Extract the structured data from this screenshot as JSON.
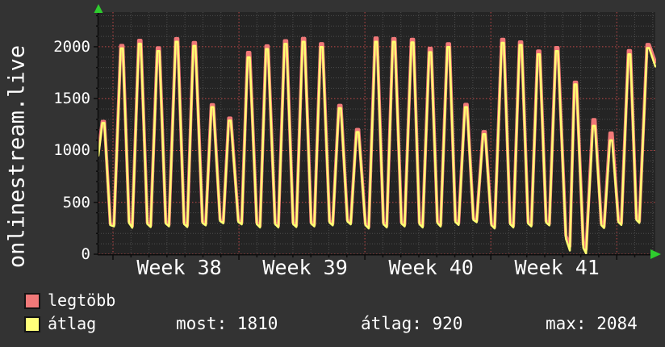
{
  "chart_data": {
    "type": "line",
    "ylabel": "onlinestream.live",
    "y_ticks": [
      0,
      500,
      1000,
      1500,
      2000
    ],
    "ylim": [
      0,
      2334
    ],
    "xlim_days": [
      0,
      30.95
    ],
    "week_start_day": 0.807,
    "x_tick_labels": [
      "Week 38",
      "Week 39",
      "Week 40",
      "Week 41"
    ],
    "grid": {
      "minor_y_step": 100,
      "major_y_step": 500,
      "minor_x_step_days": 1,
      "major_x_step_days": 7,
      "minor_color": "#4d4d4d",
      "major_color": "#c04848"
    },
    "series": [
      {
        "name": "legtöbb",
        "color": "#f07878",
        "points": [
          [
            0.0,
            1000
          ],
          [
            0.21,
            1280
          ],
          [
            0.33,
            1280
          ],
          [
            0.66,
            295
          ],
          [
            0.86,
            283
          ],
          [
            1.24,
            2012
          ],
          [
            1.36,
            2012
          ],
          [
            1.7,
            315
          ],
          [
            1.88,
            270
          ],
          [
            2.24,
            2062
          ],
          [
            2.36,
            2062
          ],
          [
            2.72,
            305
          ],
          [
            2.9,
            277
          ],
          [
            3.27,
            1990
          ],
          [
            3.39,
            1990
          ],
          [
            3.74,
            310
          ],
          [
            3.92,
            283
          ],
          [
            4.29,
            2078
          ],
          [
            4.41,
            2078
          ],
          [
            4.76,
            305
          ],
          [
            4.94,
            277
          ],
          [
            5.27,
            2040
          ],
          [
            5.39,
            2040
          ],
          [
            5.78,
            315
          ],
          [
            5.96,
            293
          ],
          [
            6.27,
            1442
          ],
          [
            6.39,
            1442
          ],
          [
            6.76,
            335
          ],
          [
            6.94,
            313
          ],
          [
            7.24,
            1312
          ],
          [
            7.36,
            1312
          ],
          [
            7.78,
            325
          ],
          [
            7.96,
            303
          ],
          [
            8.29,
            1945
          ],
          [
            8.41,
            1945
          ],
          [
            8.8,
            305
          ],
          [
            8.98,
            273
          ],
          [
            9.31,
            2008
          ],
          [
            9.43,
            2008
          ],
          [
            9.82,
            305
          ],
          [
            10.0,
            273
          ],
          [
            10.34,
            2058
          ],
          [
            10.46,
            2058
          ],
          [
            10.82,
            305
          ],
          [
            11.0,
            277
          ],
          [
            11.34,
            2080
          ],
          [
            11.46,
            2080
          ],
          [
            11.82,
            310
          ],
          [
            12.0,
            283
          ],
          [
            12.34,
            2030
          ],
          [
            12.46,
            2030
          ],
          [
            12.84,
            320
          ],
          [
            13.02,
            293
          ],
          [
            13.36,
            1435
          ],
          [
            13.48,
            1435
          ],
          [
            13.84,
            330
          ],
          [
            14.02,
            303
          ],
          [
            14.34,
            1202
          ],
          [
            14.46,
            1202
          ],
          [
            14.84,
            295
          ],
          [
            15.02,
            263
          ],
          [
            15.37,
            2084
          ],
          [
            15.49,
            2084
          ],
          [
            15.84,
            305
          ],
          [
            16.02,
            273
          ],
          [
            16.36,
            2078
          ],
          [
            16.48,
            2078
          ],
          [
            16.84,
            310
          ],
          [
            17.02,
            283
          ],
          [
            17.39,
            2072
          ],
          [
            17.51,
            2072
          ],
          [
            17.84,
            305
          ],
          [
            18.02,
            273
          ],
          [
            18.38,
            1985
          ],
          [
            18.5,
            1985
          ],
          [
            18.84,
            315
          ],
          [
            19.02,
            283
          ],
          [
            19.39,
            2028
          ],
          [
            19.51,
            2028
          ],
          [
            19.84,
            325
          ],
          [
            20.02,
            297
          ],
          [
            20.37,
            1444
          ],
          [
            20.49,
            1444
          ],
          [
            20.84,
            345
          ],
          [
            21.02,
            323
          ],
          [
            21.38,
            1182
          ],
          [
            21.5,
            1182
          ],
          [
            21.84,
            295
          ],
          [
            22.02,
            263
          ],
          [
            22.41,
            2072
          ],
          [
            22.53,
            2072
          ],
          [
            22.88,
            305
          ],
          [
            23.06,
            273
          ],
          [
            23.4,
            2046
          ],
          [
            23.52,
            2046
          ],
          [
            23.88,
            310
          ],
          [
            24.06,
            283
          ],
          [
            24.41,
            1958
          ],
          [
            24.53,
            1958
          ],
          [
            24.88,
            320
          ],
          [
            25.06,
            293
          ],
          [
            25.42,
            1992
          ],
          [
            25.54,
            1992
          ],
          [
            25.98,
            180
          ],
          [
            26.2,
            75
          ],
          [
            26.45,
            1658
          ],
          [
            26.57,
            1658
          ],
          [
            26.95,
            95
          ],
          [
            27.1,
            45
          ],
          [
            27.48,
            1298
          ],
          [
            27.6,
            1298
          ],
          [
            27.95,
            295
          ],
          [
            28.1,
            267
          ],
          [
            28.43,
            1168
          ],
          [
            28.55,
            1168
          ],
          [
            28.9,
            325
          ],
          [
            29.06,
            297
          ],
          [
            29.45,
            1962
          ],
          [
            29.57,
            1962
          ],
          [
            29.9,
            345
          ],
          [
            30.06,
            317
          ],
          [
            30.49,
            2022
          ],
          [
            30.61,
            2022
          ],
          [
            30.95,
            1855
          ]
        ]
      },
      {
        "name": "átlag",
        "color": "#ffff72",
        "points": [
          [
            0.0,
            950
          ],
          [
            0.21,
            1265
          ],
          [
            0.33,
            1265
          ],
          [
            0.66,
            280
          ],
          [
            0.86,
            268
          ],
          [
            1.24,
            1985
          ],
          [
            1.36,
            1985
          ],
          [
            1.7,
            300
          ],
          [
            1.88,
            255
          ],
          [
            2.24,
            2030
          ],
          [
            2.36,
            2030
          ],
          [
            2.72,
            290
          ],
          [
            2.9,
            262
          ],
          [
            3.27,
            1958
          ],
          [
            3.39,
            1958
          ],
          [
            3.74,
            295
          ],
          [
            3.92,
            268
          ],
          [
            4.29,
            2048
          ],
          [
            4.41,
            2048
          ],
          [
            4.76,
            290
          ],
          [
            4.94,
            262
          ],
          [
            5.27,
            2008
          ],
          [
            5.39,
            2008
          ],
          [
            5.78,
            300
          ],
          [
            5.96,
            278
          ],
          [
            6.27,
            1418
          ],
          [
            6.39,
            1418
          ],
          [
            6.76,
            320
          ],
          [
            6.94,
            298
          ],
          [
            7.24,
            1288
          ],
          [
            7.36,
            1288
          ],
          [
            7.78,
            310
          ],
          [
            7.96,
            288
          ],
          [
            8.29,
            1898
          ],
          [
            8.41,
            1898
          ],
          [
            8.8,
            290
          ],
          [
            8.98,
            258
          ],
          [
            9.31,
            1978
          ],
          [
            9.43,
            1978
          ],
          [
            9.82,
            290
          ],
          [
            10.0,
            258
          ],
          [
            10.34,
            2028
          ],
          [
            10.46,
            2028
          ],
          [
            10.82,
            290
          ],
          [
            11.0,
            262
          ],
          [
            11.34,
            2048
          ],
          [
            11.46,
            2048
          ],
          [
            11.82,
            295
          ],
          [
            12.0,
            268
          ],
          [
            12.34,
            1998
          ],
          [
            12.46,
            1998
          ],
          [
            12.84,
            305
          ],
          [
            13.02,
            278
          ],
          [
            13.36,
            1408
          ],
          [
            13.48,
            1408
          ],
          [
            13.84,
            315
          ],
          [
            14.02,
            288
          ],
          [
            14.34,
            1178
          ],
          [
            14.46,
            1178
          ],
          [
            14.84,
            280
          ],
          [
            15.02,
            248
          ],
          [
            15.37,
            2048
          ],
          [
            15.49,
            2048
          ],
          [
            15.84,
            290
          ],
          [
            16.02,
            258
          ],
          [
            16.36,
            2048
          ],
          [
            16.48,
            2048
          ],
          [
            16.84,
            295
          ],
          [
            17.02,
            268
          ],
          [
            17.39,
            2042
          ],
          [
            17.51,
            2042
          ],
          [
            17.84,
            290
          ],
          [
            18.02,
            258
          ],
          [
            18.38,
            1948
          ],
          [
            18.5,
            1948
          ],
          [
            18.84,
            300
          ],
          [
            19.02,
            268
          ],
          [
            19.39,
            1998
          ],
          [
            19.51,
            1998
          ],
          [
            19.84,
            310
          ],
          [
            20.02,
            282
          ],
          [
            20.37,
            1418
          ],
          [
            20.49,
            1418
          ],
          [
            20.84,
            330
          ],
          [
            21.02,
            308
          ],
          [
            21.38,
            1158
          ],
          [
            21.5,
            1158
          ],
          [
            21.84,
            280
          ],
          [
            22.02,
            248
          ],
          [
            22.41,
            2038
          ],
          [
            22.53,
            2038
          ],
          [
            22.88,
            290
          ],
          [
            23.06,
            258
          ],
          [
            23.4,
            2018
          ],
          [
            23.52,
            2018
          ],
          [
            23.88,
            295
          ],
          [
            24.06,
            268
          ],
          [
            24.41,
            1928
          ],
          [
            24.53,
            1928
          ],
          [
            24.88,
            305
          ],
          [
            25.06,
            278
          ],
          [
            25.42,
            1958
          ],
          [
            25.54,
            1958
          ],
          [
            25.98,
            150
          ],
          [
            26.2,
            35
          ],
          [
            26.45,
            1638
          ],
          [
            26.57,
            1638
          ],
          [
            26.95,
            60
          ],
          [
            27.1,
            8
          ],
          [
            27.48,
            1238
          ],
          [
            27.6,
            1238
          ],
          [
            27.95,
            280
          ],
          [
            28.1,
            252
          ],
          [
            28.43,
            1098
          ],
          [
            28.55,
            1098
          ],
          [
            28.9,
            310
          ],
          [
            29.06,
            282
          ],
          [
            29.45,
            1928
          ],
          [
            29.57,
            1928
          ],
          [
            29.9,
            330
          ],
          [
            30.06,
            302
          ],
          [
            30.49,
            1988
          ],
          [
            30.61,
            1988
          ],
          [
            30.95,
            1810
          ]
        ]
      }
    ]
  },
  "legend": {
    "items": [
      {
        "label": "legtöbb",
        "color": "#f17979"
      },
      {
        "label": "átlag",
        "color": "#ffff7a"
      }
    ]
  },
  "stats": {
    "most": "most: 1810",
    "atlag": "átlag: 920",
    "max": "max: 2084"
  },
  "colors": {
    "background": "#333333",
    "plot_background": "#242424",
    "axis": "#0c0c0c",
    "arrow_green": "#2ecc2e",
    "text": "#ffffff"
  }
}
